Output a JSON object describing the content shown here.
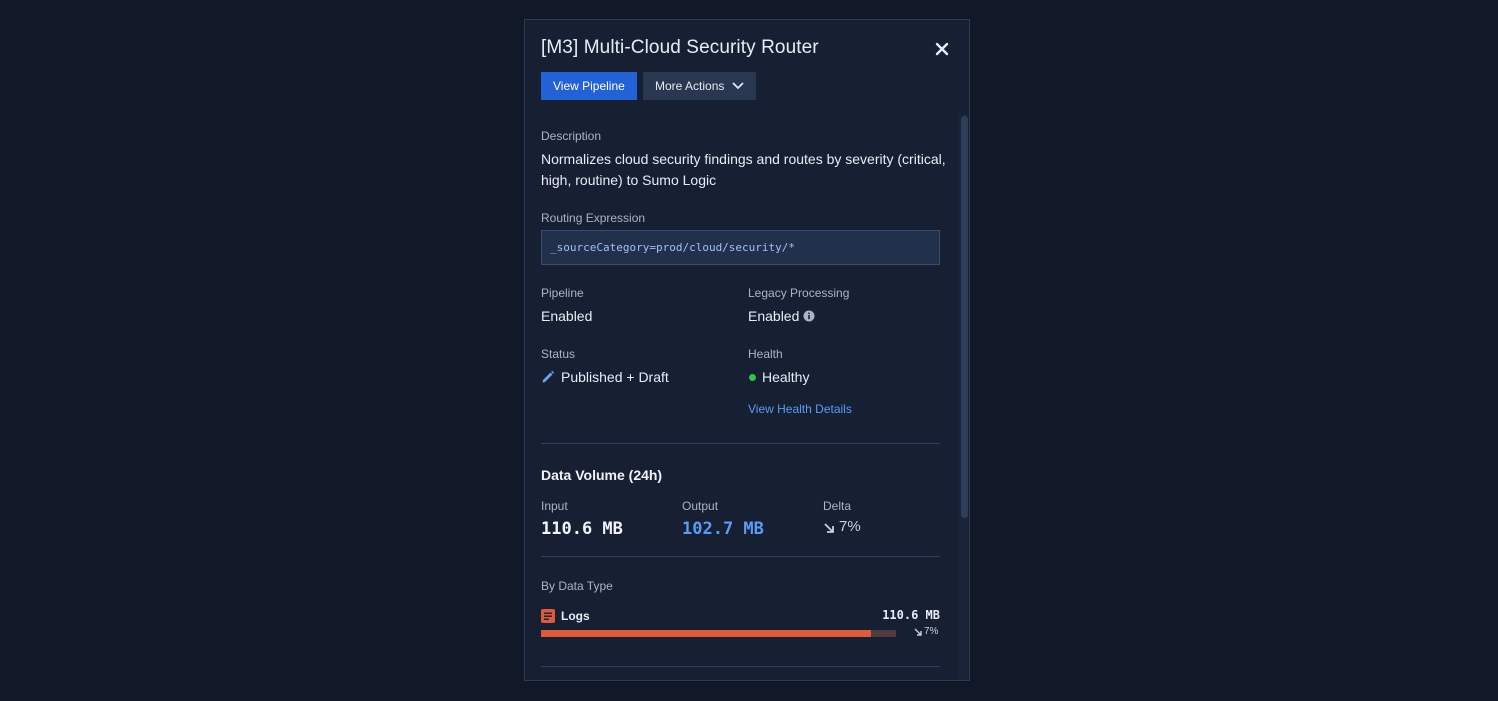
{
  "panel": {
    "title": "[M3] Multi-Cloud Security Router",
    "view_pipeline": "View Pipeline",
    "more_actions": "More Actions"
  },
  "details": {
    "description_label": "Description",
    "description_line1": "Normalizes cloud security findings and routes by severity (critical,",
    "description_line2": "high, routine) to Sumo Logic",
    "routing_label": "Routing Expression",
    "routing_value": "_sourceCategory=prod/cloud/security/*",
    "pipeline_label": "Pipeline",
    "pipeline_value": "Enabled",
    "legacy_label": "Legacy Processing",
    "legacy_value": "Enabled",
    "status_label": "Status",
    "status_value": "Published + Draft",
    "health_label": "Health",
    "health_value": "Healthy",
    "health_link": "View Health Details"
  },
  "volume": {
    "heading": "Data Volume (24h)",
    "input_label": "Input",
    "input_value": "110.6 MB",
    "output_label": "Output",
    "output_value": "102.7 MB",
    "delta_label": "Delta",
    "delta_value": "7%",
    "by_type_label": "By Data Type",
    "logs_label": "Logs",
    "logs_value": "110.6 MB",
    "logs_delta": "7%",
    "logs_output_fraction": 0.93
  },
  "colors": {
    "primary": "#2361d6",
    "link": "#5b9bf5",
    "logs": "#e05a3a",
    "healthy": "#35c14a"
  }
}
